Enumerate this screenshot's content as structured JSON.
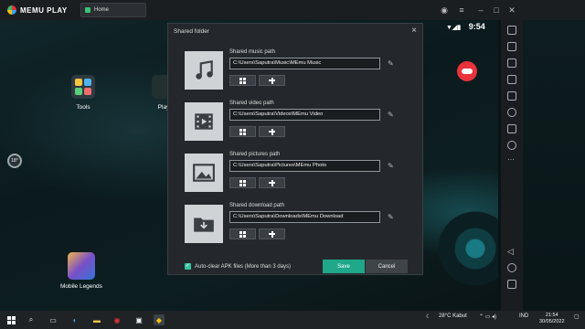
{
  "app": {
    "title": "MEMU PLAY",
    "tab_label": "Home"
  },
  "status_bar": {
    "time": "9:54"
  },
  "desktop": {
    "icons": [
      {
        "label": "Tools"
      },
      {
        "label": "Play"
      },
      {
        "label": "Mobile Legends"
      }
    ],
    "badge": "18°"
  },
  "dialog": {
    "title": "Shared folder",
    "close_icon": "close-icon",
    "rows": [
      {
        "label": "Shared music path",
        "path": "C:\\Users\\Saputra\\Music\\MEmu Music",
        "icon": "music-note-icon"
      },
      {
        "label": "Shared video path",
        "path": "C:\\Users\\Saputra\\Videos\\MEmu Video",
        "icon": "film-icon"
      },
      {
        "label": "Shared pictures path",
        "path": "C:\\Users\\Saputra\\Pictures\\MEmu Photo",
        "icon": "picture-icon"
      },
      {
        "label": "Shared download path",
        "path": "C:\\Users\\Saputra\\Downloads\\MEmu Download",
        "icon": "download-folder-icon"
      }
    ],
    "auto_clear_label": "Auto-clear APK files (More than 3 days)",
    "auto_clear_checked": true,
    "save_label": "Save",
    "cancel_label": "Cancel"
  },
  "taskbar": {
    "weather": "28°C  Kabut",
    "lang": "IND",
    "clock_time": "21:54",
    "clock_date": "30/05/2022"
  },
  "colors": {
    "accent": "#1fa78a",
    "gamepad": "#e8333a"
  }
}
